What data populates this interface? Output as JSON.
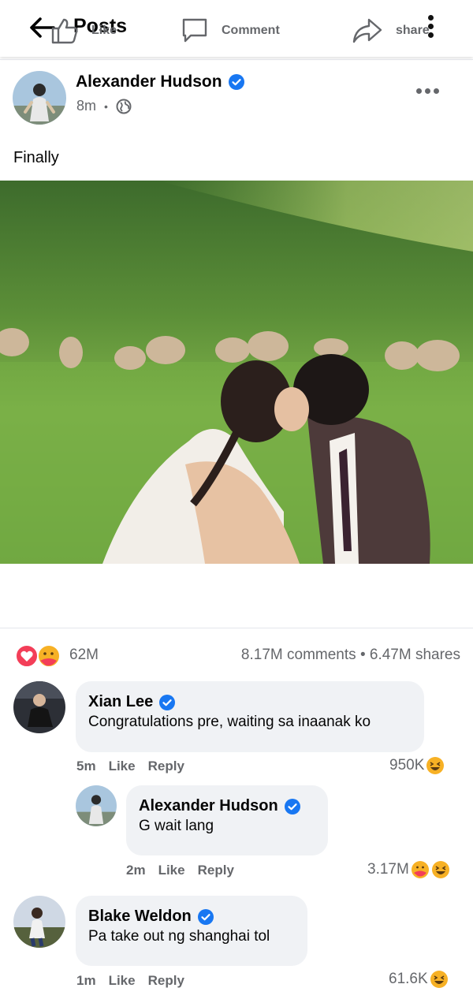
{
  "header": {
    "title": "Posts"
  },
  "post": {
    "author": "Alexander Hudson",
    "time": "8m",
    "caption": "Finally",
    "reaction_count": "62M",
    "comments_count": "8.17M comments",
    "shares_count": "6.47M shares",
    "actions": {
      "like": "Like",
      "comment": "Comment",
      "share": "share"
    }
  },
  "comments": [
    {
      "author": "Xian Lee",
      "text": "Congratulations pre, waiting sa inaanak ko",
      "time": "5m",
      "like": "Like",
      "reply": "Reply",
      "reactions": "950K",
      "reaction_icons": [
        "haha-icon"
      ]
    },
    {
      "author": "Alexander Hudson",
      "text": "G wait lang",
      "time": "2m",
      "like": "Like",
      "reply": "Reply",
      "reactions": "3.17M",
      "reaction_icons": [
        "care-icon",
        "haha-icon"
      ],
      "is_reply": true
    },
    {
      "author": "Blake Weldon",
      "text": "Pa take out ng shanghai tol",
      "time": "1m",
      "like": "Like",
      "reply": "Reply",
      "reactions": "61.6K",
      "reaction_icons": [
        "haha-icon"
      ]
    }
  ],
  "colors": {
    "verified": "#1877f2",
    "muted": "#65676b",
    "bubble": "#f0f2f5",
    "love": "#f33e58",
    "haha": "#f7b125"
  }
}
